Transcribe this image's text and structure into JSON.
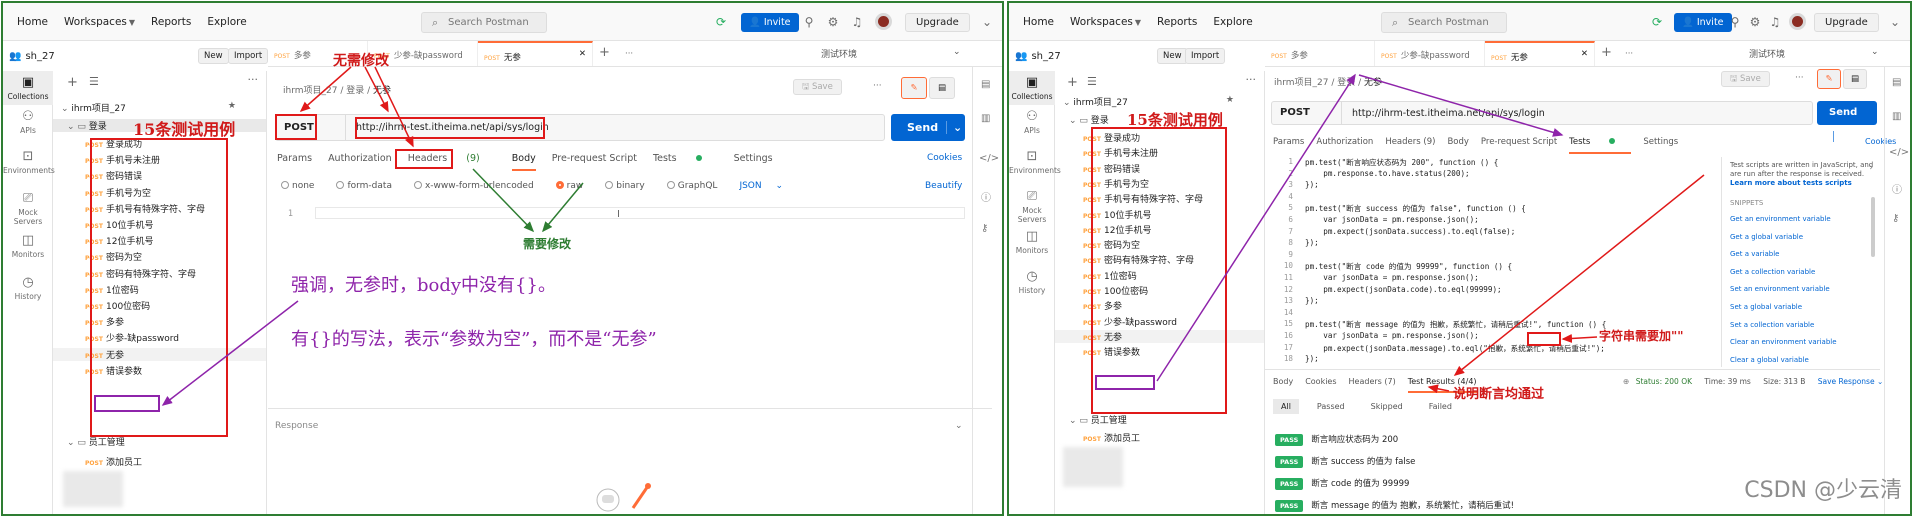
{
  "topbar": {
    "home": "Home",
    "workspaces": "Workspaces",
    "reports": "Reports",
    "explore": "Explore",
    "search_placeholder": "Search Postman",
    "invite": "Invite",
    "upgrade": "Upgrade"
  },
  "workspace": {
    "name": "sh_27",
    "new_label": "New",
    "import_label": "Import"
  },
  "rail": [
    "Collections",
    "APIs",
    "Environments",
    "Mock Servers",
    "Monitors",
    "History"
  ],
  "tabs_left": [
    {
      "m": "POST",
      "label": "多参"
    },
    {
      "m": "POST",
      "label": "少参-缺password"
    },
    {
      "m": "POST",
      "label": "无参"
    }
  ],
  "tabs_right": [
    {
      "m": "POST",
      "label": "多参"
    },
    {
      "m": "POST",
      "label": "少参-缺password"
    },
    {
      "m": "POST",
      "label": "无参"
    }
  ],
  "env": "测试环境",
  "breadcrumb": {
    "root": "ihrm项目_27",
    "mid": "登录",
    "leaf": "无参"
  },
  "save_label": "Save",
  "tree": {
    "collection": "ihrm项目_27",
    "folder": "登录",
    "items": [
      "登录成功",
      "手机号未注册",
      "密码错误",
      "手机号为空",
      "手机号有特殊字符、字母",
      "10位手机号",
      "12位手机号",
      "密码为空",
      "密码有特殊字符、字母",
      "1位密码",
      "100位密码",
      "多参",
      "少参-缺password",
      "无参",
      "错误参数"
    ],
    "folder2": "员工管理",
    "item2": "添加员工",
    "method": "POST"
  },
  "request": {
    "method": "POST",
    "url": "http://ihrm-test.itheima.net/api/sys/login",
    "send": "Send",
    "cookies": "Cookies",
    "beautify": "Beautify",
    "json": "JSON",
    "response": "Response"
  },
  "subtabs_left": [
    "Params",
    "Authorization",
    "Headers",
    "(9)",
    "Body",
    "Pre-request Script",
    "Tests",
    "Settings"
  ],
  "subtabs_right": [
    "Params",
    "Authorization",
    "Headers (9)",
    "Body",
    "Pre-request Script",
    "Tests",
    "Settings"
  ],
  "body_types": [
    "none",
    "form-data",
    "x-www-form-urlencoded",
    "raw",
    "binary",
    "GraphQL"
  ],
  "annotations": {
    "no_change": "无需修改",
    "cases_15": "15条测试用例",
    "need_change": "需要修改",
    "emph1": "强调，无参时，body中没有{}。",
    "emph2": "有{}的写法，表示“参数为空”，而不是“无参”",
    "string_note": "字符串需要加\"\"",
    "assert_pass": "说明断言均通过"
  },
  "code_lines": [
    {
      "n": "1",
      "t": "pm.test(\"断言响应状态码为 200\", function () {"
    },
    {
      "n": "2",
      "t": "    pm.response.to.have.status(200);"
    },
    {
      "n": "3",
      "t": "});"
    },
    {
      "n": "4",
      "t": ""
    },
    {
      "n": "5",
      "t": "pm.test(\"断言 success 的值为 false\", function () {"
    },
    {
      "n": "6",
      "t": "    var jsonData = pm.response.json();"
    },
    {
      "n": "7",
      "t": "    pm.expect(jsonData.success).to.eql(false);"
    },
    {
      "n": "8",
      "t": "});"
    },
    {
      "n": "9",
      "t": ""
    },
    {
      "n": "10",
      "t": "pm.test(\"断言 code 的值为 99999\", function () {"
    },
    {
      "n": "11",
      "t": "    var jsonData = pm.response.json();"
    },
    {
      "n": "12",
      "t": "    pm.expect(jsonData.code).to.eql(99999);"
    },
    {
      "n": "13",
      "t": "});"
    },
    {
      "n": "14",
      "t": ""
    },
    {
      "n": "15",
      "t": "pm.test(\"断言 message 的值为 抱歉，系统繁忙，请稍后重试!\", function () {"
    },
    {
      "n": "16",
      "t": "    var jsonData = pm.response.json();"
    },
    {
      "n": "17",
      "t": "    pm.expect(jsonData.message).to.eql(\"抱歉，系统繁忙，请稍后重试!\");"
    },
    {
      "n": "18",
      "t": "});"
    }
  ],
  "snippets": {
    "desc1": "Test scripts are written in JavaScript, and",
    "desc2": "are run after the response is received.",
    "learn": "Learn more about tests scripts",
    "title": "SNIPPETS",
    "items": [
      "Get an environment variable",
      "Get a global variable",
      "Get a variable",
      "Get a collection variable",
      "Set an environment variable",
      "Set a global variable",
      "Set a collection variable",
      "Clear an environment variable",
      "Clear a global variable"
    ]
  },
  "response_tabs": [
    "Body",
    "Cookies",
    "Headers (7)",
    "Test Results (4/4)"
  ],
  "status": {
    "status": "Status: 200 OK",
    "time": "Time: 39 ms",
    "size": "Size: 313 B",
    "save": "Save Response"
  },
  "filters": [
    "All",
    "Passed",
    "Skipped",
    "Failed"
  ],
  "results": [
    {
      "badge": "PASS",
      "text": "断言响应状态码为 200"
    },
    {
      "badge": "PASS",
      "text": "断言 success 的值为 false"
    },
    {
      "badge": "PASS",
      "text": "断言 code 的值为 99999"
    },
    {
      "badge": "PASS",
      "text": "断言 message 的值为 抱歉，系统繁忙，请稍后重试!"
    }
  ],
  "watermark": "CSDN @少云清"
}
